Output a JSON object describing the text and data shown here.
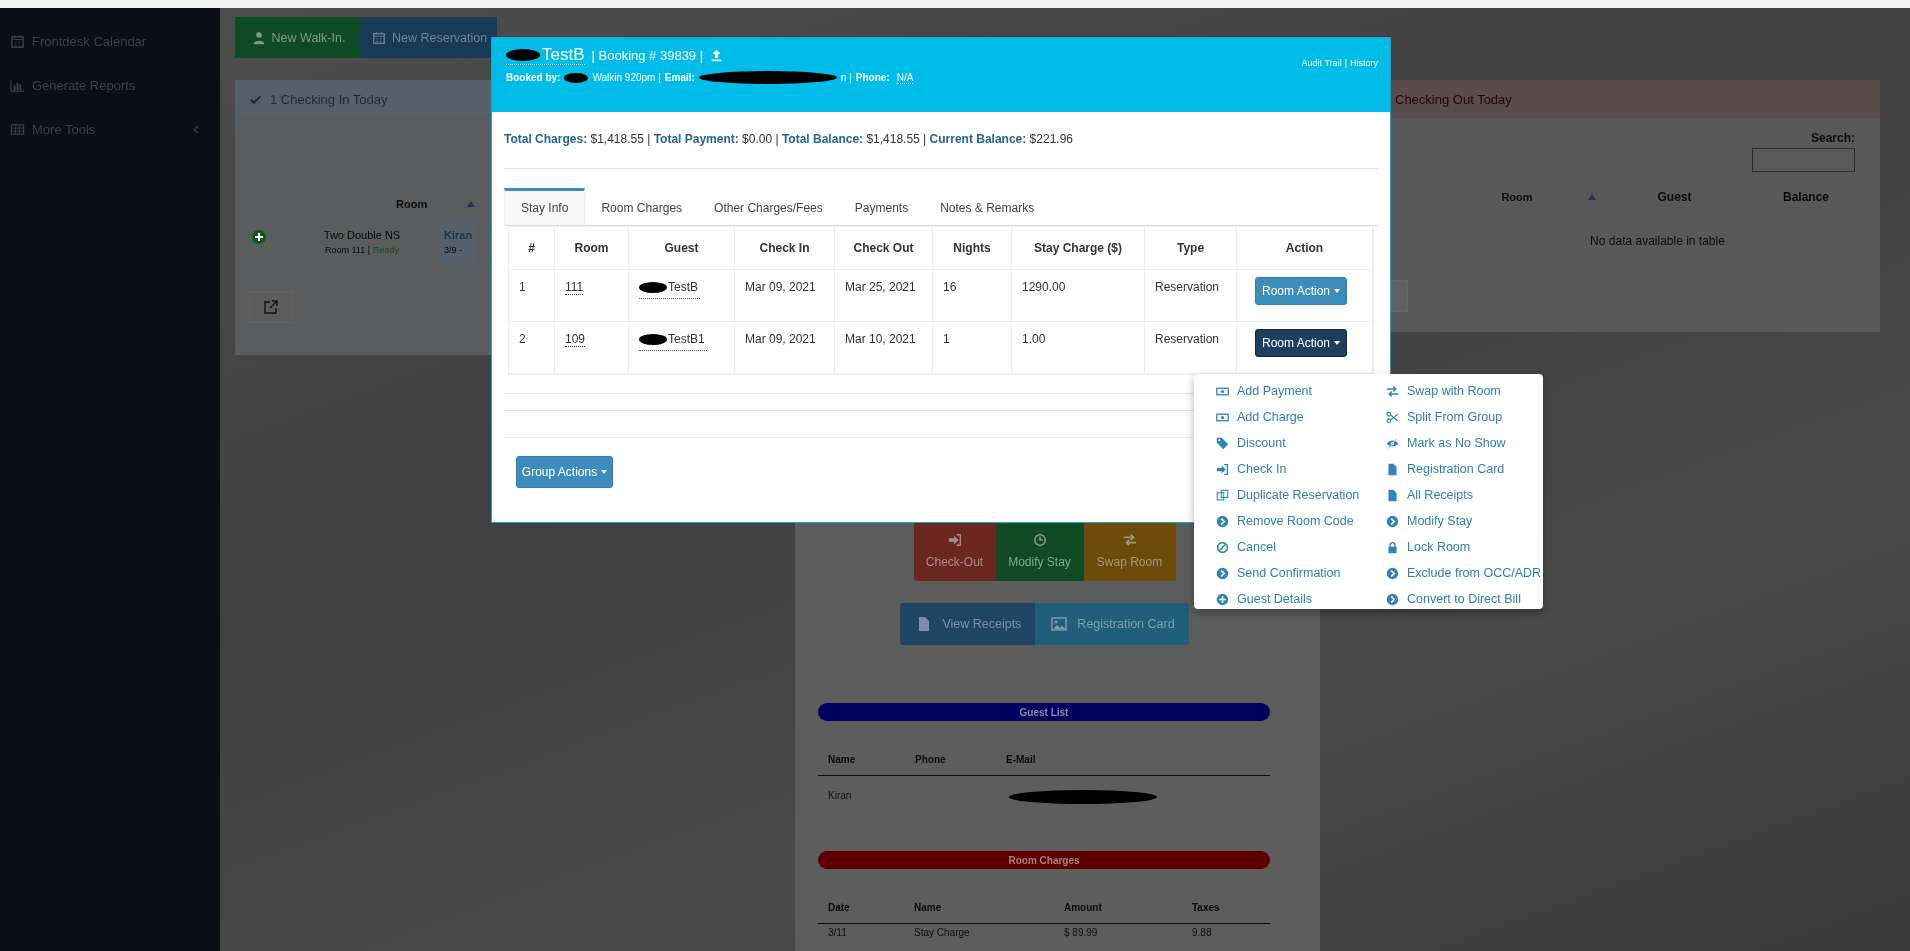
{
  "sidebar": {
    "items": [
      {
        "label": "Frontdesk Calendar",
        "kind": "calendar"
      },
      {
        "label": "Generate Reports",
        "kind": "reports"
      },
      {
        "label": "More Tools",
        "kind": "submenu"
      }
    ]
  },
  "toolbar": {
    "buttons": [
      {
        "label": "New Walk-In.",
        "kind": "walk_in"
      },
      {
        "label": "New Reservation",
        "kind": "reservation"
      }
    ]
  },
  "checkin_panel": {
    "title": "1 Checking In Today",
    "columns": [
      "Room"
    ],
    "rows": [
      {
        "room_type": "Two Double NS",
        "room_label": "Room 111 |",
        "status": "Ready",
        "guest": "Kiran",
        "dates": "3/9 -"
      }
    ]
  },
  "checkout_panel": {
    "title": "Checking Out Today",
    "search_label": "Search:",
    "columns": [
      "Room",
      "Guest",
      "Balance"
    ],
    "empty_text": "No data available in table"
  },
  "room_panel": {
    "actions": [
      {
        "label": "Check-Out",
        "kind": "checkout"
      },
      {
        "label": "Modify Stay",
        "kind": "modify"
      },
      {
        "label": "Swap Room",
        "kind": "swap"
      }
    ],
    "links": [
      {
        "label": "View Receipts",
        "kind": "receipts"
      },
      {
        "label": "Registration Card",
        "kind": "card"
      }
    ],
    "guest_list": {
      "title": "Guest List",
      "columns": [
        "Name",
        "Phone",
        "E-Mail"
      ],
      "rows": [
        {
          "name": "Kiran",
          "email_redacted": true
        }
      ]
    },
    "room_charges": {
      "title": "Room Charges",
      "columns": [
        "Date",
        "Name",
        "Amount",
        "Taxes"
      ],
      "rows": [
        [
          "3/11",
          "Stay Charge",
          "$ 89.99",
          "9.88"
        ]
      ]
    }
  },
  "booking_modal": {
    "name_redacted": true,
    "guest_name": "TestB",
    "booking": "| Booking # 39839 |",
    "booked_by_label": "Booked by:",
    "booked_by": "Walkin 920pm |",
    "email_label": "Email:",
    "email_tail": "n |",
    "phone_label": "Phone:",
    "phone": "N/A",
    "links": [
      "Audit Trail",
      "History"
    ],
    "link_separator": "|",
    "totals": "**Total Charges:** $1,418.55 | **Total Payment:** $0.00 | **Total Balance:** $1,418.55 | **Current Balance:** $221.96",
    "tabs": [
      {
        "label": "Stay Info",
        "selected": true
      },
      {
        "label": "Room Charges",
        "selected": false
      },
      {
        "label": "Other Charges/Fees",
        "selected": false
      },
      {
        "label": "Payments",
        "selected": false
      },
      {
        "label": "Notes & Remarks",
        "selected": false
      }
    ],
    "table": {
      "columns": [
        "#",
        "Room",
        "Guest",
        "Check In",
        "Check Out",
        "Nights",
        "Stay Charge ($)",
        "Type",
        "Action"
      ],
      "rows": [
        {
          "num": "1",
          "room": "111",
          "guest": "TestB",
          "check_in": "Mar 09, 2021",
          "check_out": "Mar 25, 2021",
          "nights": "16",
          "stay_charge": "1290.00",
          "type": "Reservation",
          "action": "Room Action",
          "menu_open": false
        },
        {
          "num": "2",
          "room": "109",
          "guest": "TestB1",
          "check_in": "Mar 09, 2021",
          "check_out": "Mar 10, 2021",
          "nights": "1",
          "stay_charge": "1.00",
          "type": "Reservation",
          "action": "Room Action",
          "menu_open": true
        }
      ]
    },
    "group_actions": "Group Actions"
  },
  "room_action_menu": {
    "left": [
      "Add Payment",
      "Add Charge",
      "Discount",
      "Check In",
      "Duplicate Reservation",
      "Remove Room Code",
      "Cancel",
      "Send Confirmation",
      "Guest Details"
    ],
    "right": [
      "Swap with Room",
      "Split From Group",
      "Mark as No Show",
      "Registration Card",
      "All Receipts",
      "Modify Stay",
      "Lock Room",
      "Exclude from OCC/ADR",
      "Convert to Direct Bill"
    ]
  }
}
